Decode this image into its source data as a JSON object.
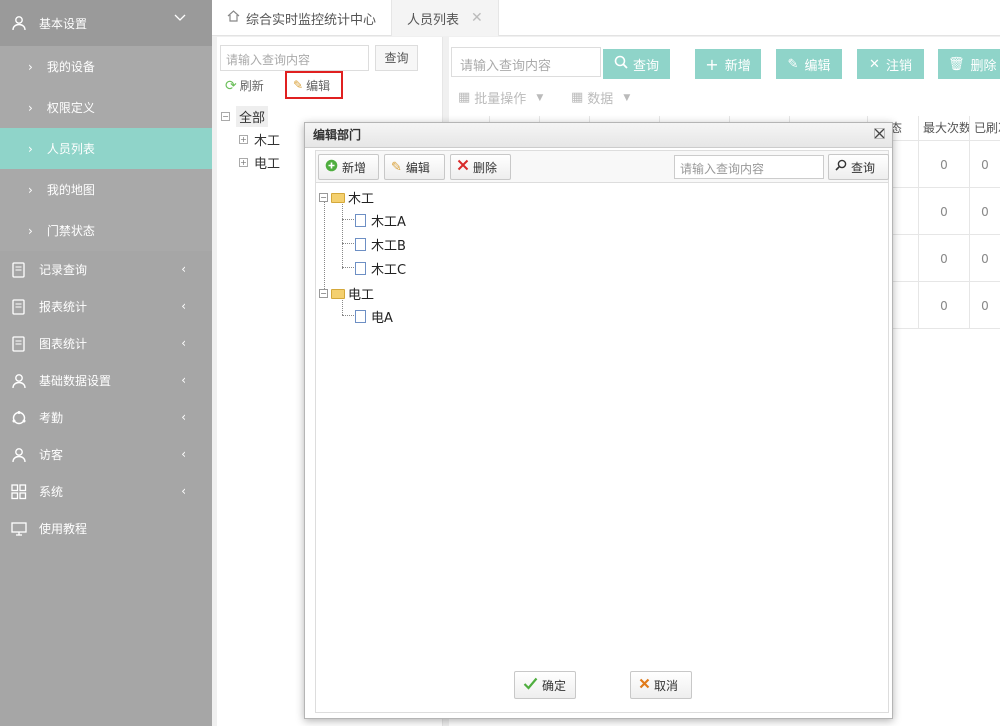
{
  "sidebar": {
    "groups": [
      {
        "label": "基本设置",
        "icon": "user-icon"
      },
      {
        "label": "记录查询",
        "icon": "record-icon"
      },
      {
        "label": "报表统计",
        "icon": "report-icon"
      },
      {
        "label": "图表统计",
        "icon": "chart-icon"
      },
      {
        "label": "基础数据设置",
        "icon": "user-icon"
      },
      {
        "label": "考勤",
        "icon": "attendance-icon"
      },
      {
        "label": "访客",
        "icon": "user-icon"
      },
      {
        "label": "系统",
        "icon": "grid-icon"
      },
      {
        "label": "使用教程",
        "icon": "tutorial-icon"
      }
    ],
    "sub_items": [
      "我的设备",
      "权限定义",
      "人员列表",
      "我的地图",
      "门禁状态"
    ],
    "active_sub": "人员列表"
  },
  "tabs": [
    {
      "label": "综合实时监控统计中心"
    },
    {
      "label": "人员列表"
    }
  ],
  "left_panel": {
    "search_placeholder": "请输入查询内容",
    "query_label": "查询",
    "refresh_label": "刷新",
    "edit_label": "编辑",
    "tree": {
      "root": "全部",
      "children": [
        "木工",
        "电工"
      ]
    }
  },
  "main": {
    "search_placeholder": "请输入查询内容",
    "query_label": "查询",
    "add_label": "新增",
    "edit_label": "编辑",
    "logout_label": "注销",
    "delete_label": "删除",
    "batch_label": "批量操作",
    "data_label": "数据",
    "columns": [
      "态",
      "最大次数",
      "已刷次"
    ],
    "rows": [
      [
        "0",
        "0"
      ],
      [
        "0",
        "0"
      ],
      [
        "0",
        "0"
      ],
      [
        "0",
        "0"
      ]
    ]
  },
  "dialog": {
    "title": "编辑部门",
    "add_label": "新增",
    "edit_label": "编辑",
    "delete_label": "删除",
    "search_placeholder": "请输入查询内容",
    "query_label": "查询",
    "tree": [
      {
        "label": "木工",
        "children": [
          "木工A",
          "木工B",
          "木工C"
        ]
      },
      {
        "label": "电工",
        "children": [
          "电A"
        ]
      }
    ],
    "ok_label": "确定",
    "cancel_label": "取消"
  },
  "colors": {
    "accent": "#8fd4c9",
    "sidebar": "#a6a6a6",
    "highlight": "#e02020"
  }
}
